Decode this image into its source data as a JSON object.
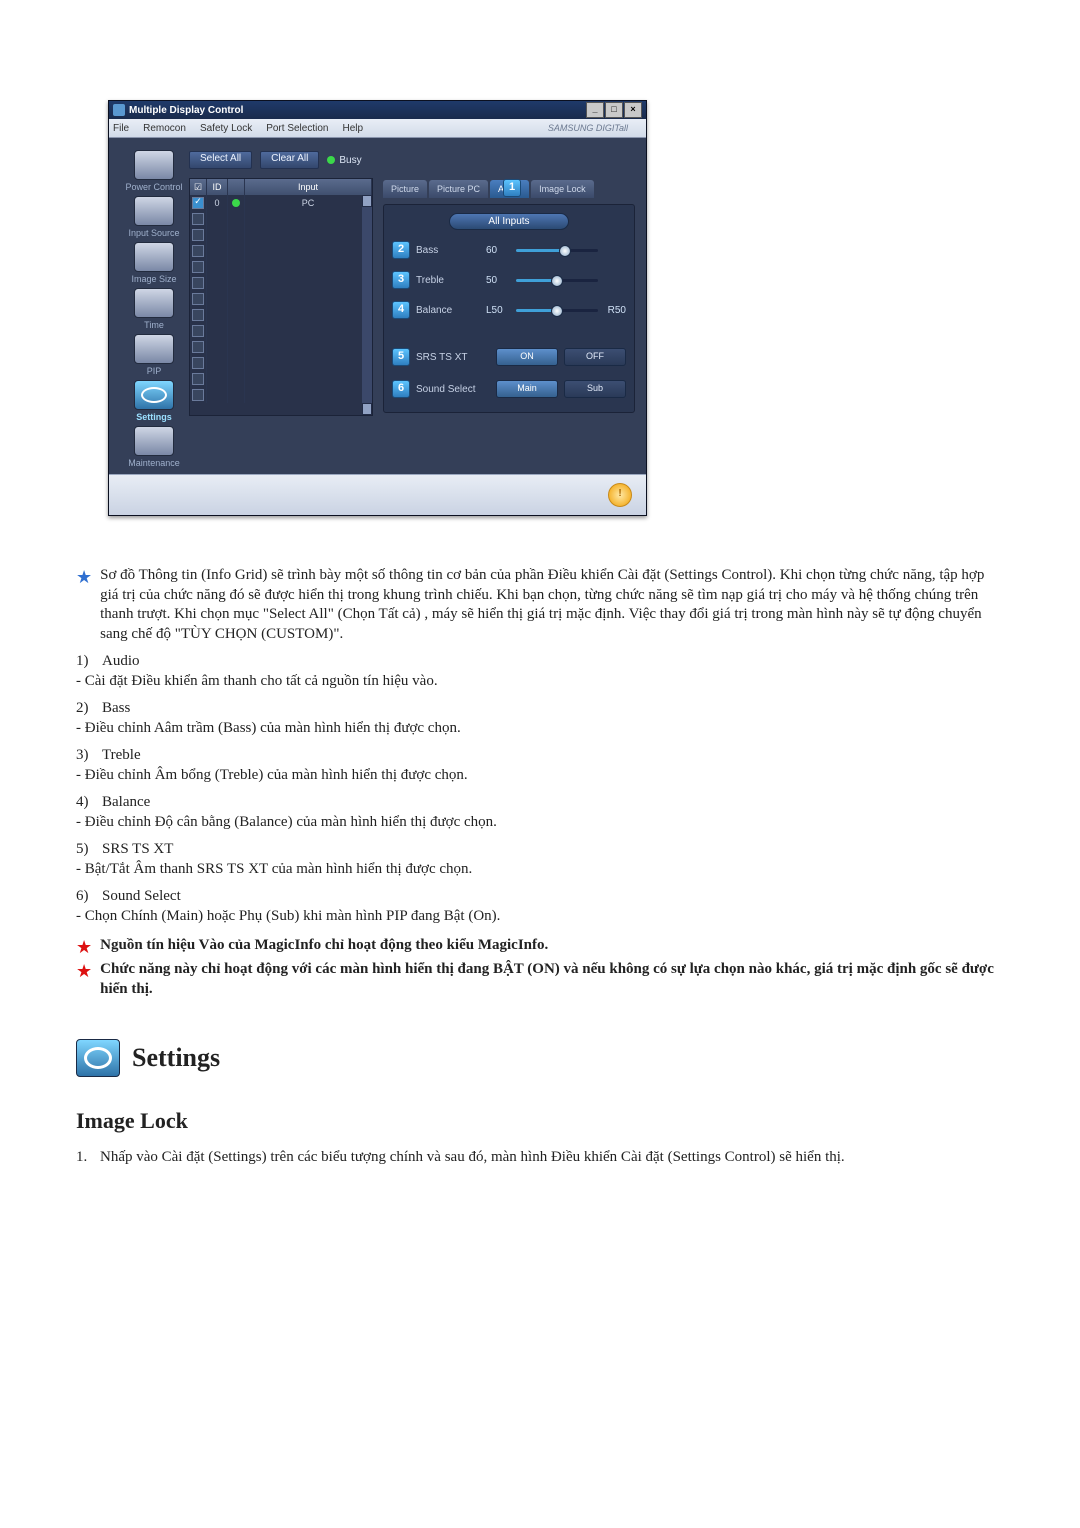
{
  "app": {
    "title": "Multiple Display Control",
    "brand": "SAMSUNG DIGITall",
    "menu": [
      "File",
      "Remocon",
      "Safety Lock",
      "Port Selection",
      "Help"
    ],
    "toolbar": {
      "select_all": "Select All",
      "clear_all": "Clear All",
      "busy": "Busy"
    },
    "grid": {
      "headers": {
        "id": "ID",
        "input": "Input"
      },
      "row0": {
        "id": "0",
        "input": "PC"
      }
    },
    "tabs": {
      "picture": "Picture",
      "picture_pc": "Picture PC",
      "audio": "Audio",
      "image_lock": "Image Lock"
    },
    "panel": {
      "all_inputs": "All Inputs",
      "bass": {
        "label": "Bass",
        "value": "60"
      },
      "treble": {
        "label": "Treble",
        "value": "50"
      },
      "balance": {
        "label": "Balance",
        "value": "L50",
        "suffix": "R50"
      },
      "srs": {
        "label": "SRS TS XT",
        "on": "ON",
        "off": "OFF"
      },
      "sound_select": {
        "label": "Sound Select",
        "main": "Main",
        "sub": "Sub"
      }
    },
    "callouts": {
      "c1": "1",
      "c2": "2",
      "c3": "3",
      "c4": "4",
      "c5": "5",
      "c6": "6"
    }
  },
  "sidebar": {
    "power": "Power Control",
    "input": "Input Source",
    "image_size": "Image Size",
    "time": "Time",
    "pip": "PIP",
    "settings": "Settings",
    "maintenance": "Maintenance"
  },
  "doc": {
    "note_intro": "Sơ đồ Thông tin (Info Grid) sẽ trình bày một số thông tin cơ bản của phần Điều khiển Cài đặt (Settings Control). Khi chọn từng chức năng, tập hợp giá trị của chức năng đó sẽ được hiển thị trong khung trình chiếu. Khi bạn chọn, từng chức năng sẽ tìm nạp giá trị cho máy và hệ thống chúng trên thanh trượt. Khi chọn mục \"Select All\" (Chọn Tất cả) , máy sẽ hiển thị giá trị mặc định. Việc thay đổi giá trị trong màn hình này sẽ tự động chuyển sang chế độ \"TÙY CHỌN (CUSTOM)\".",
    "items": [
      {
        "num": "1)",
        "title": "Audio",
        "desc": "- Cài đặt Điều khiển âm thanh cho tất cả nguồn tín hiệu vào."
      },
      {
        "num": "2)",
        "title": "Bass",
        "desc": "- Điều chỉnh Aâm trầm (Bass) của màn hình hiển thị được chọn."
      },
      {
        "num": "3)",
        "title": "Treble",
        "desc": "- Điều chỉnh Âm bổng (Treble) của màn hình hiển thị được chọn."
      },
      {
        "num": "4)",
        "title": "Balance",
        "desc": "- Điều chỉnh Độ cân bằng (Balance) của màn hình hiển thị được chọn."
      },
      {
        "num": "5)",
        "title": "SRS TS XT",
        "desc": "- Bật/Tắt Âm thanh SRS TS XT của màn hình hiển thị được chọn."
      },
      {
        "num": "6)",
        "title": "Sound Select",
        "desc": "- Chọn Chính (Main) hoặc Phụ (Sub) khi màn hình PIP đang Bật (On)."
      }
    ],
    "note_magicinfo": "Nguồn tín hiệu Vào của MagicInfo chỉ hoạt động theo kiểu MagicInfo.",
    "note_on": "Chức năng này chỉ hoạt động với các màn hình hiển thị đang BẬT (ON) và nếu không có sự lựa chọn nào khác, giá trị mặc định gốc sẽ được hiển thị.",
    "section_title": "Settings",
    "subhead": "Image Lock",
    "ol1_num": "1.",
    "ol1_text": "Nhấp vào Cài đặt (Settings) trên các biểu tượng chính và sau đó, màn hình Điều khiển Cài đặt (Settings Control) sẽ hiển thị."
  }
}
